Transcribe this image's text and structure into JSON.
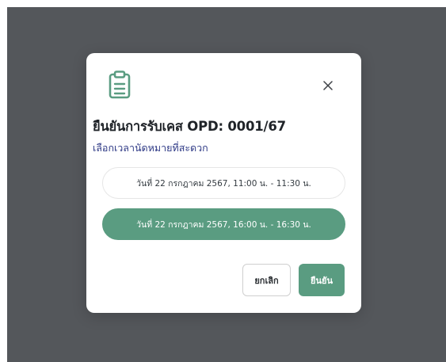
{
  "dialog": {
    "title": "ยืนยันการรับเคส OPD: 0001/67",
    "subtitle": "เลือกเวลานัดหมายที่สะดวก",
    "icon": "clipboard-icon",
    "close_icon": "close-icon",
    "slots": [
      {
        "label": "วันที่ 22 กรกฎาคม 2567, 11:00 น. - 11:30 น.",
        "selected": false
      },
      {
        "label": "วันที่ 22 กรกฎาคม 2567, 16:00 น. - 16:30 น.",
        "selected": true
      }
    ],
    "cancel_label": "ยกเลิก",
    "confirm_label": "ยืนยัน"
  },
  "colors": {
    "overlay": "#54575b",
    "accent": "#5a9c81",
    "subtitle": "#2f3a86",
    "title": "#1f2328"
  }
}
